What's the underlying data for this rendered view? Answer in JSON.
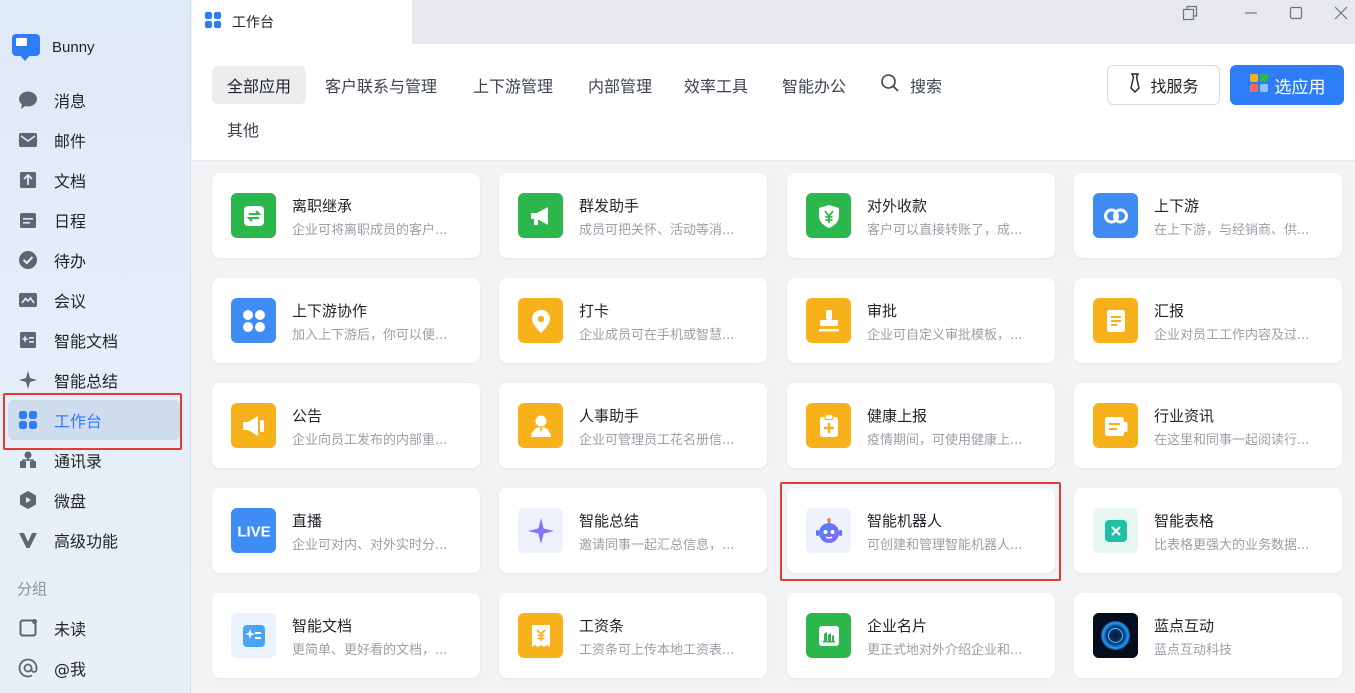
{
  "app": {
    "username": "Bunny"
  },
  "sidebar": {
    "items": [
      {
        "label": "消息",
        "icon": "chat-bubble-icon",
        "active": false
      },
      {
        "label": "邮件",
        "icon": "mail-icon",
        "active": false
      },
      {
        "label": "文档",
        "icon": "document-icon",
        "active": false
      },
      {
        "label": "日程",
        "icon": "calendar-icon",
        "active": false
      },
      {
        "label": "待办",
        "icon": "check-circle-icon",
        "active": false
      },
      {
        "label": "会议",
        "icon": "meeting-icon",
        "active": false
      },
      {
        "label": "智能文档",
        "icon": "smart-doc-icon",
        "active": false
      },
      {
        "label": "智能总结",
        "icon": "sparkle-icon",
        "active": false
      },
      {
        "label": "工作台",
        "icon": "workbench-grid-icon",
        "active": true
      },
      {
        "label": "通讯录",
        "icon": "contacts-icon",
        "active": false
      },
      {
        "label": "微盘",
        "icon": "cloud-drive-icon",
        "active": false
      },
      {
        "label": "高级功能",
        "icon": "advanced-v-icon",
        "active": false
      }
    ],
    "group_label": "分组",
    "group_items": [
      {
        "label": "未读",
        "icon": "unread-square-icon"
      },
      {
        "label": "@我",
        "icon": "at-icon"
      }
    ]
  },
  "tab": {
    "label": "工作台"
  },
  "header": {
    "categories": [
      "全部应用",
      "客户联系与管理",
      "上下游管理",
      "内部管理",
      "效率工具",
      "智能办公",
      "其他"
    ],
    "active_category": "全部应用",
    "search_label": "搜索",
    "find_service_label": "找服务",
    "choose_app_label": "选应用"
  },
  "apps": [
    {
      "title": "离职继承",
      "desc": "企业可将离职成员的客户...",
      "icon": "resign-transfer-icon",
      "color": "#2bb74c"
    },
    {
      "title": "群发助手",
      "desc": "成员可把关怀、活动等消...",
      "icon": "megaphone-icon",
      "color": "#2bb74c"
    },
    {
      "title": "对外收款",
      "desc": "客户可以直接转账了，成...",
      "icon": "yuan-shield-icon",
      "color": "#2bb74c"
    },
    {
      "title": "上下游",
      "desc": "在上下游，与经销商、供...",
      "icon": "link-chain-icon",
      "color": "#3f8cf5"
    },
    {
      "title": "上下游协作",
      "desc": "加入上下游后，你可以便...",
      "icon": "clover-icon",
      "color": "#3f8cf5"
    },
    {
      "title": "打卡",
      "desc": "企业成员可在手机或智慧...",
      "icon": "location-pin-icon",
      "color": "#f7b21b"
    },
    {
      "title": "审批",
      "desc": "企业可自定义审批模板，...",
      "icon": "stamp-icon",
      "color": "#f7b21b"
    },
    {
      "title": "汇报",
      "desc": "企业对员工工作内容及过...",
      "icon": "report-doc-icon",
      "color": "#f7b21b"
    },
    {
      "title": "公告",
      "desc": "企业向员工发布的内部重...",
      "icon": "announcement-icon",
      "color": "#f7b21b"
    },
    {
      "title": "人事助手",
      "desc": "企业可管理员工花名册信...",
      "icon": "person-icon",
      "color": "#f7b21b"
    },
    {
      "title": "健康上报",
      "desc": "疫情期间，可使用健康上...",
      "icon": "health-clipboard-icon",
      "color": "#f7b21b"
    },
    {
      "title": "行业资讯",
      "desc": "在这里和同事一起阅读行...",
      "icon": "news-icon",
      "color": "#f7b21b"
    },
    {
      "title": "直播",
      "desc": "企业可对内、对外实时分...",
      "icon": "live-icon",
      "color": "#3f8cf5"
    },
    {
      "title": "智能总结",
      "desc": "邀请同事一起汇总信息，...",
      "icon": "sparkle-icon",
      "color": "#eef2fd"
    },
    {
      "title": "智能机器人",
      "desc": "可创建和管理智能机器人...",
      "icon": "robot-icon",
      "color": "#eef2fd"
    },
    {
      "title": "智能表格",
      "desc": "比表格更强大的业务数据...",
      "icon": "smart-sheet-icon",
      "color": "#e8f7f3"
    },
    {
      "title": "智能文档",
      "desc": "更简单、更好看的文档，...",
      "icon": "smart-doc-icon",
      "color": "#eaf3fd"
    },
    {
      "title": "工资条",
      "desc": "工资条可上传本地工资表...",
      "icon": "payslip-icon",
      "color": "#f7b21b"
    },
    {
      "title": "企业名片",
      "desc": "更正式地对外介绍企业和...",
      "icon": "business-card-icon",
      "color": "#2bb74c"
    },
    {
      "title": "蓝点互动",
      "desc": "蓝点互动科技",
      "icon": "blue-dot-logo-icon",
      "color": "#0a1a33"
    }
  ]
}
